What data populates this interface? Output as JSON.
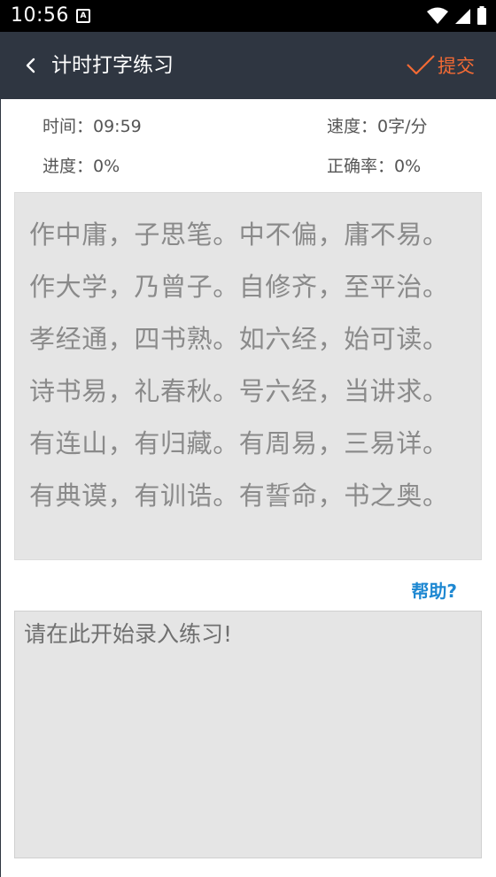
{
  "status_bar": {
    "time": "10:56",
    "notif_icon": "a-icon",
    "icons": [
      "wifi-icon",
      "signal-icon",
      "battery-icon"
    ]
  },
  "app_bar": {
    "title": "计时打字练习",
    "back_icon": "chevron-left-icon",
    "submit_label": "提交",
    "submit_icon": "checkmark-icon",
    "background": "#2f3641",
    "accent": "#f36a34"
  },
  "stats": {
    "time_label": "时间：09:59",
    "speed_label": "速度：0字/分",
    "progress_label": "进度：0%",
    "accuracy_label": "正确率：0%"
  },
  "reference_text": {
    "lines": [
      "作中庸，子思笔。中不偏，庸不易。",
      "作大学，乃曾子。自修齐，至平治。",
      "孝经通，四书熟。如六经，始可读。",
      "诗书易，礼春秋。号六经，当讲求。",
      "有连山，有归藏。有周易，三易详。",
      "有典谟，有训诰。有誓命，书之奥。"
    ]
  },
  "help": {
    "label": "帮助?",
    "color": "#1e88d2"
  },
  "input": {
    "placeholder": "请在此开始录入练习!",
    "value": ""
  }
}
